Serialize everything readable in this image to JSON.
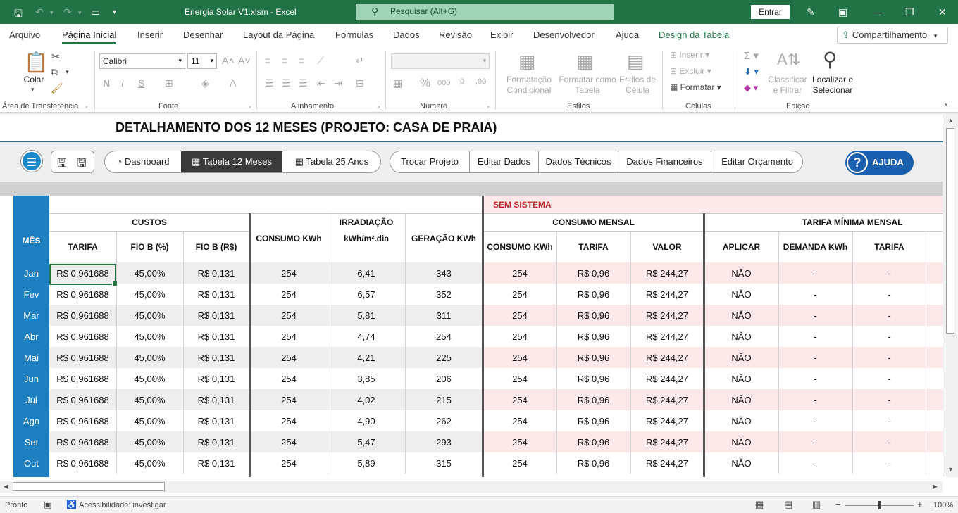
{
  "window": {
    "title": "Energia Solar V1.xlsm  -  Excel",
    "search_placeholder": "Pesquisar (Alt+G)",
    "signin": "Entrar"
  },
  "menu": {
    "items": [
      "Arquivo",
      "Página Inicial",
      "Inserir",
      "Desenhar",
      "Layout da Página",
      "Fórmulas",
      "Dados",
      "Revisão",
      "Exibir",
      "Desenvolvedor",
      "Ajuda",
      "Design da Tabela"
    ],
    "share": "Compartilhamento"
  },
  "ribbon": {
    "clipboard": {
      "paste": "Colar",
      "label": "Área de Transferência"
    },
    "font": {
      "name": "Calibri",
      "size": "11",
      "label": "Fonte"
    },
    "alignment": {
      "label": "Alinhamento"
    },
    "number": {
      "label": "Número"
    },
    "styles": {
      "cond_format": "Formatação Condicional",
      "format_table": "Formatar como Tabela",
      "cell_styles": "Estilos de Célula",
      "label": "Estilos"
    },
    "cells": {
      "insert": "Inserir",
      "delete": "Excluir",
      "format": "Formatar",
      "label": "Células"
    },
    "editing": {
      "sort": "Classificar e Filtrar",
      "find": "Localizar e Selecionar",
      "label": "Edição"
    }
  },
  "sheet": {
    "title": "DETALHAMENTO DOS 12 MESES (PROJETO: CASA DE PRAIA)",
    "nav": {
      "dashboard": "Dashboard",
      "tabela12": "Tabela 12 Meses",
      "tabela25": "Tabela 25 Anos",
      "trocar": "Trocar Projeto",
      "editar_dados": "Editar Dados",
      "dados_tecnicos": "Dados Técnicos",
      "dados_financeiros": "Dados Financeiros",
      "editar_orcamento": "Editar Orçamento",
      "ajuda": "AJUDA"
    },
    "headers": {
      "mes": "MÊS",
      "custos": "CUSTOS",
      "tarifa": "TARIFA",
      "fio_b_pct": "FIO B (%)",
      "fio_b_rs": "FIO B (R$)",
      "consumo": "CONSUMO KWh",
      "irradiacao_1": "IRRADIAÇÃO",
      "irradiacao_2": "kWh/m².dia",
      "geracao": "GERAÇÃO KWh",
      "sem_sistema": "SEM SISTEMA",
      "consumo_mensal": "CONSUMO MENSAL",
      "cm_consumo": "CONSUMO KWh",
      "cm_tarifa": "TARIFA",
      "cm_valor": "VALOR",
      "tarifa_minima": "TARIFA MÍNIMA MENSAL",
      "tm_aplicar": "APLICAR",
      "tm_demanda": "DEMANDA KWh",
      "tm_tarifa": "TARIFA"
    },
    "rows": [
      {
        "mes": "Jan",
        "tarifa": "R$ 0,961688",
        "fio_pct": "45,00%",
        "fio_rs": "R$ 0,131",
        "consumo": "254",
        "irrad": "6,41",
        "geracao": "343",
        "cm_consumo": "254",
        "cm_tarifa": "R$ 0,96",
        "cm_valor": "R$ 244,27",
        "aplicar": "NÃO",
        "demanda": "-",
        "tm_tarifa": "-"
      },
      {
        "mes": "Fev",
        "tarifa": "R$ 0,961688",
        "fio_pct": "45,00%",
        "fio_rs": "R$ 0,131",
        "consumo": "254",
        "irrad": "6,57",
        "geracao": "352",
        "cm_consumo": "254",
        "cm_tarifa": "R$ 0,96",
        "cm_valor": "R$ 244,27",
        "aplicar": "NÃO",
        "demanda": "-",
        "tm_tarifa": "-"
      },
      {
        "mes": "Mar",
        "tarifa": "R$ 0,961688",
        "fio_pct": "45,00%",
        "fio_rs": "R$ 0,131",
        "consumo": "254",
        "irrad": "5,81",
        "geracao": "311",
        "cm_consumo": "254",
        "cm_tarifa": "R$ 0,96",
        "cm_valor": "R$ 244,27",
        "aplicar": "NÃO",
        "demanda": "-",
        "tm_tarifa": "-"
      },
      {
        "mes": "Abr",
        "tarifa": "R$ 0,961688",
        "fio_pct": "45,00%",
        "fio_rs": "R$ 0,131",
        "consumo": "254",
        "irrad": "4,74",
        "geracao": "254",
        "cm_consumo": "254",
        "cm_tarifa": "R$ 0,96",
        "cm_valor": "R$ 244,27",
        "aplicar": "NÃO",
        "demanda": "-",
        "tm_tarifa": "-"
      },
      {
        "mes": "Mai",
        "tarifa": "R$ 0,961688",
        "fio_pct": "45,00%",
        "fio_rs": "R$ 0,131",
        "consumo": "254",
        "irrad": "4,21",
        "geracao": "225",
        "cm_consumo": "254",
        "cm_tarifa": "R$ 0,96",
        "cm_valor": "R$ 244,27",
        "aplicar": "NÃO",
        "demanda": "-",
        "tm_tarifa": "-"
      },
      {
        "mes": "Jun",
        "tarifa": "R$ 0,961688",
        "fio_pct": "45,00%",
        "fio_rs": "R$ 0,131",
        "consumo": "254",
        "irrad": "3,85",
        "geracao": "206",
        "cm_consumo": "254",
        "cm_tarifa": "R$ 0,96",
        "cm_valor": "R$ 244,27",
        "aplicar": "NÃO",
        "demanda": "-",
        "tm_tarifa": "-"
      },
      {
        "mes": "Jul",
        "tarifa": "R$ 0,961688",
        "fio_pct": "45,00%",
        "fio_rs": "R$ 0,131",
        "consumo": "254",
        "irrad": "4,02",
        "geracao": "215",
        "cm_consumo": "254",
        "cm_tarifa": "R$ 0,96",
        "cm_valor": "R$ 244,27",
        "aplicar": "NÃO",
        "demanda": "-",
        "tm_tarifa": "-"
      },
      {
        "mes": "Ago",
        "tarifa": "R$ 0,961688",
        "fio_pct": "45,00%",
        "fio_rs": "R$ 0,131",
        "consumo": "254",
        "irrad": "4,90",
        "geracao": "262",
        "cm_consumo": "254",
        "cm_tarifa": "R$ 0,96",
        "cm_valor": "R$ 244,27",
        "aplicar": "NÃO",
        "demanda": "-",
        "tm_tarifa": "-"
      },
      {
        "mes": "Set",
        "tarifa": "R$ 0,961688",
        "fio_pct": "45,00%",
        "fio_rs": "R$ 0,131",
        "consumo": "254",
        "irrad": "5,47",
        "geracao": "293",
        "cm_consumo": "254",
        "cm_tarifa": "R$ 0,96",
        "cm_valor": "R$ 244,27",
        "aplicar": "NÃO",
        "demanda": "-",
        "tm_tarifa": "-"
      },
      {
        "mes": "Out",
        "tarifa": "R$ 0,961688",
        "fio_pct": "45,00%",
        "fio_rs": "R$ 0,131",
        "consumo": "254",
        "irrad": "5,89",
        "geracao": "315",
        "cm_consumo": "254",
        "cm_tarifa": "R$ 0,96",
        "cm_valor": "R$ 244,27",
        "aplicar": "NÃO",
        "demanda": "-",
        "tm_tarifa": "-"
      }
    ]
  },
  "status": {
    "ready": "Pronto",
    "accessibility": "Acessibilidade: investigar",
    "zoom": "100%"
  },
  "colors": {
    "excel_green": "#217346",
    "month_blue": "#1d7fc0",
    "pink": "#fde9e9",
    "sem_sistema_red": "#c0282d",
    "help_blue": "#1a5fae"
  }
}
